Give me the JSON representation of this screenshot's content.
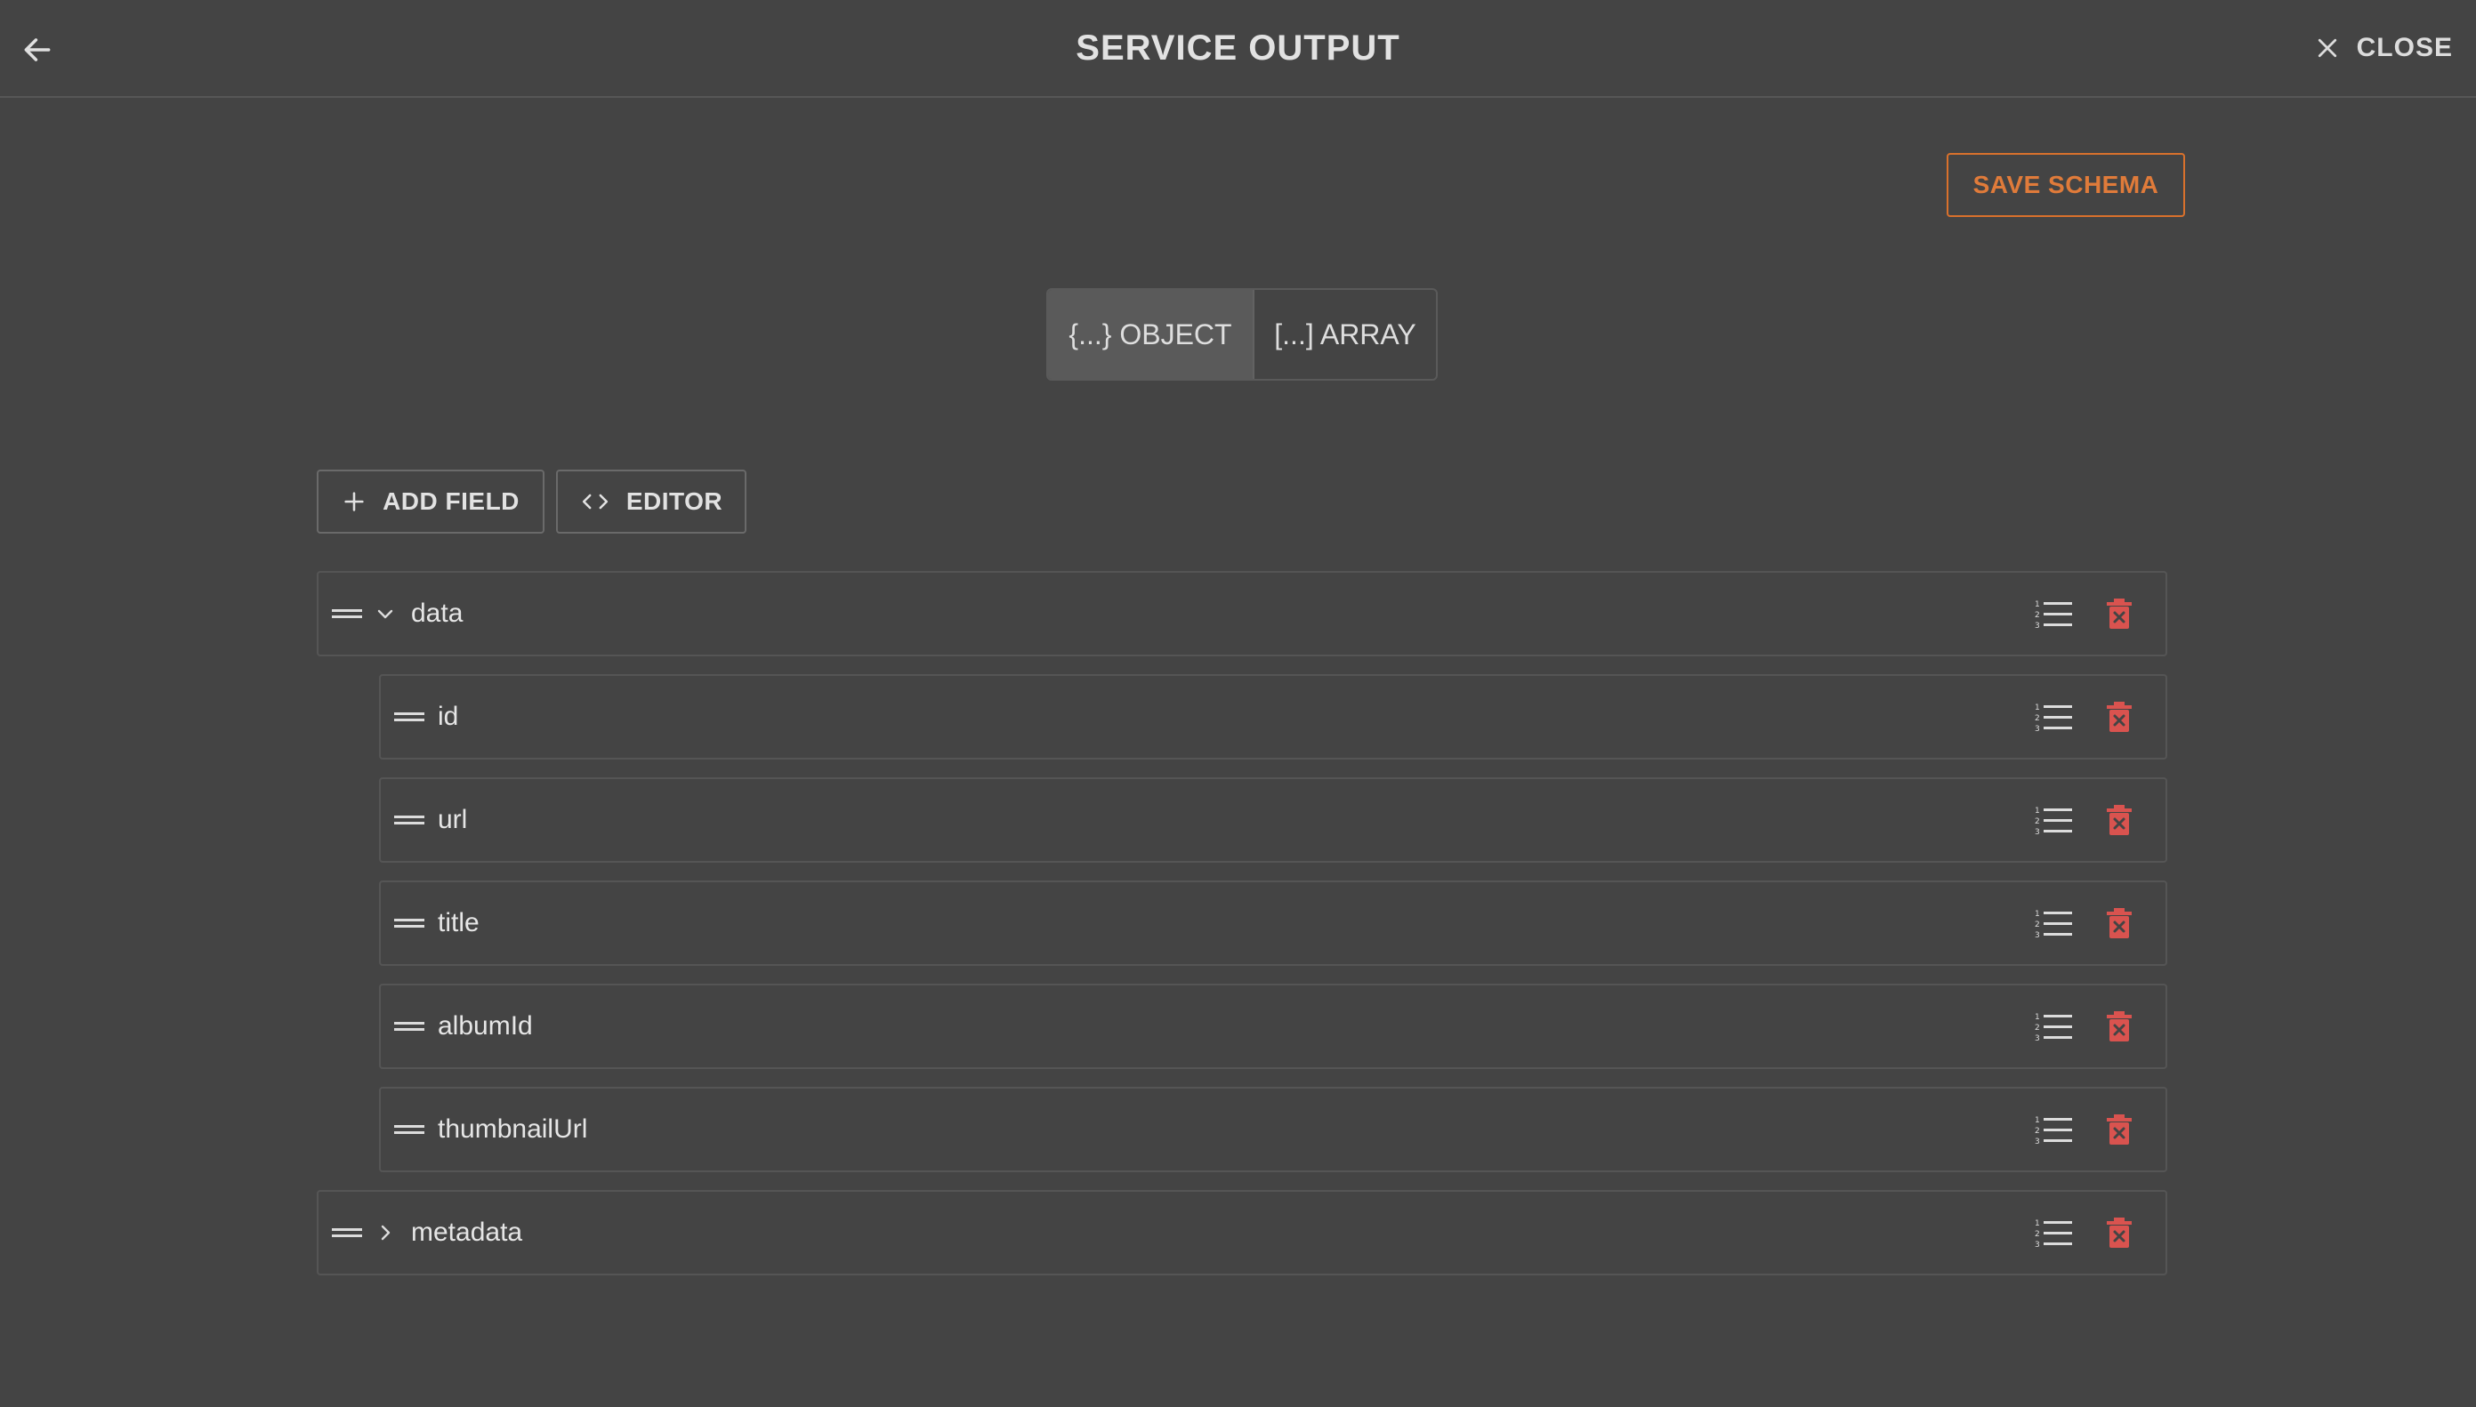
{
  "header": {
    "title": "SERVICE OUTPUT",
    "close_label": "CLOSE"
  },
  "actions": {
    "save_label": "SAVE SCHEMA"
  },
  "type_toggle": {
    "object_label": "{...} OBJECT",
    "array_label": "[...] ARRAY",
    "selected": "object"
  },
  "toolbar": {
    "add_field_label": "ADD FIELD",
    "editor_label": "EDITOR"
  },
  "fields": [
    {
      "name": "data",
      "level": 0,
      "expanded": true
    },
    {
      "name": "id",
      "level": 1
    },
    {
      "name": "url",
      "level": 1
    },
    {
      "name": "title",
      "level": 1
    },
    {
      "name": "albumId",
      "level": 1
    },
    {
      "name": "thumbnailUrl",
      "level": 1
    },
    {
      "name": "metadata",
      "level": 0,
      "expanded": false
    }
  ],
  "colors": {
    "background": "#444444",
    "accent": "#e07b3a",
    "delete": "#d9534f",
    "selected_toggle": "#5a5a5a"
  },
  "icons": {
    "back": "arrow-left-icon",
    "close": "close-icon",
    "add": "plus-icon",
    "editor": "code-icon",
    "drag": "drag-handle-icon",
    "list": "numbered-list-icon",
    "delete": "delete-icon"
  }
}
